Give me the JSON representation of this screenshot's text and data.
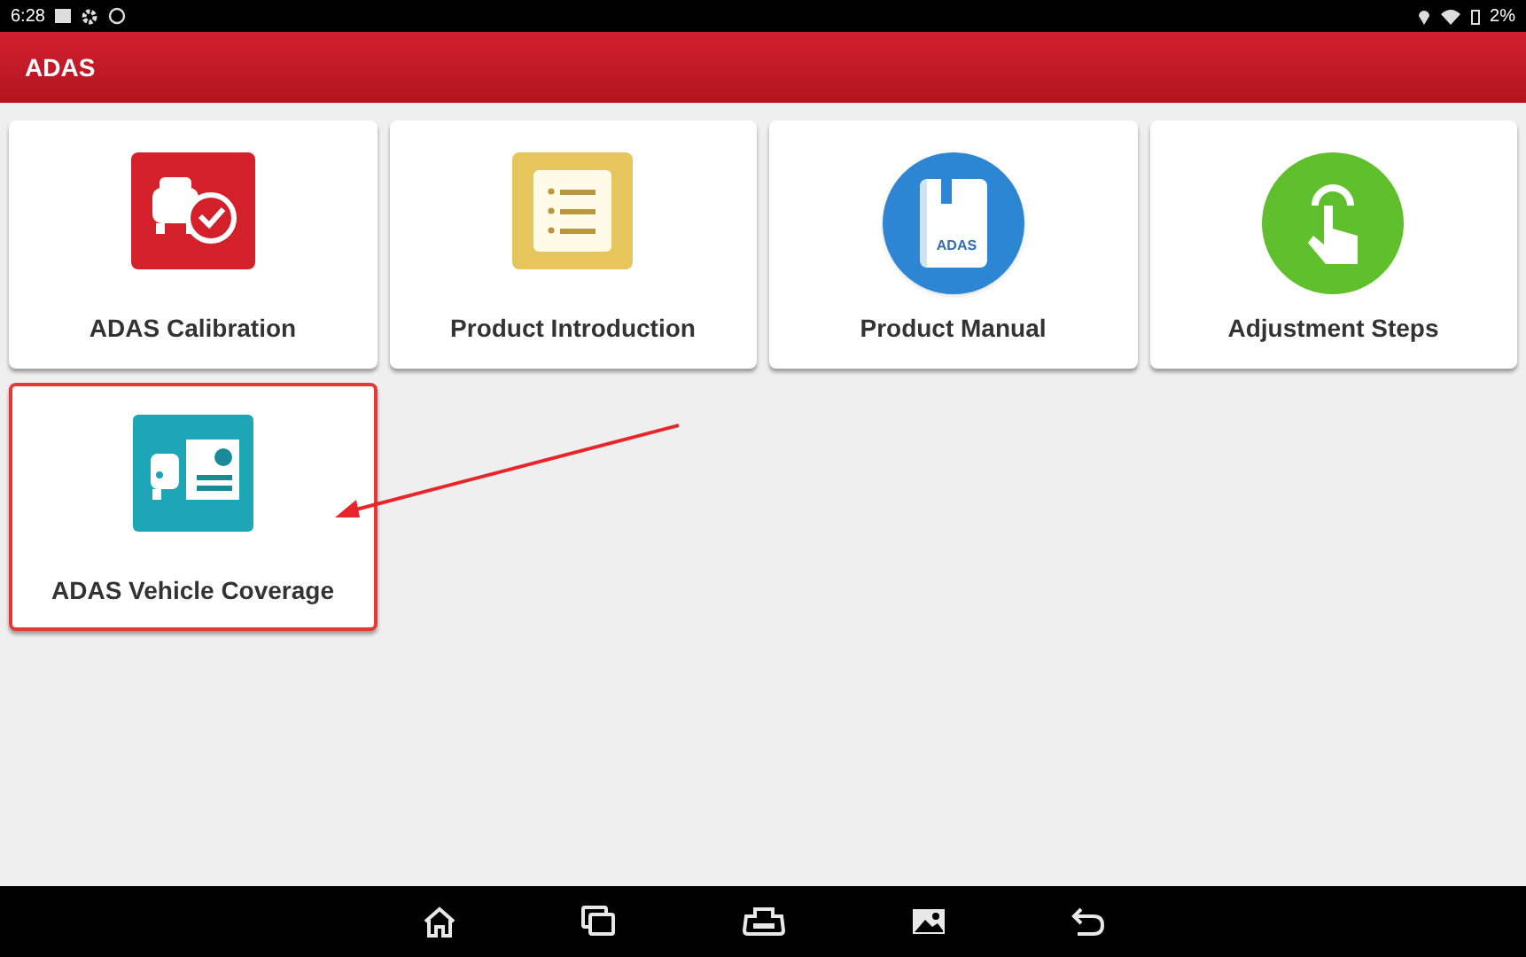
{
  "status_bar": {
    "time": "6:28",
    "battery": "2%"
  },
  "header": {
    "title": "ADAS"
  },
  "tiles": [
    {
      "label": "ADAS Calibration",
      "kind": "calibration",
      "highlighted": false
    },
    {
      "label": "Product Introduction",
      "kind": "introduction",
      "highlighted": false
    },
    {
      "label": "Product Manual",
      "kind": "manual",
      "icon_text": "ADAS",
      "highlighted": false
    },
    {
      "label": "Adjustment Steps",
      "kind": "steps",
      "highlighted": false
    },
    {
      "label": "ADAS Vehicle Coverage",
      "kind": "coverage",
      "highlighted": true
    }
  ],
  "nav_bar": [
    {
      "kind": "home"
    },
    {
      "kind": "recents"
    },
    {
      "kind": "vci"
    },
    {
      "kind": "gallery"
    },
    {
      "kind": "back"
    }
  ]
}
